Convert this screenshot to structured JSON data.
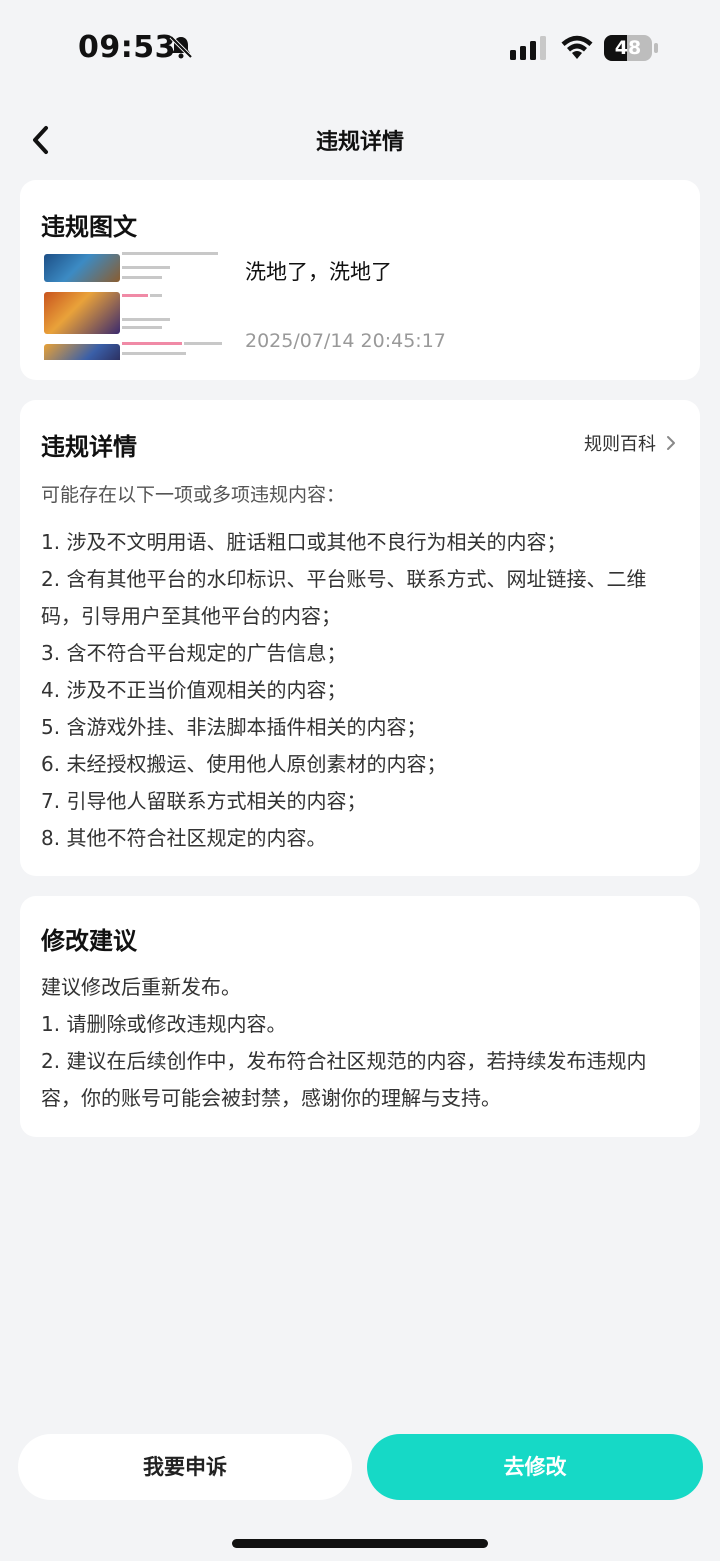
{
  "status_bar": {
    "time": "09:53",
    "battery": "48",
    "battery_level": 0.48
  },
  "nav": {
    "title": "违规详情"
  },
  "post_card": {
    "title": "违规图文",
    "post_text": "洗地了，洗地了",
    "post_time": "2025/07/14 20:45:17"
  },
  "details_card": {
    "title": "违规详情",
    "link_label": "规则百科",
    "intro": "可能存在以下一项或多项违规内容：",
    "rules": [
      "1. 涉及不文明用语、脏话粗口或其他不良行为相关的内容；",
      "2. 含有其他平台的水印标识、平台账号、联系方式、网址链接、二维码，引导用户至其他平台的内容；",
      "3. 含不符合平台规定的广告信息；",
      "4. 涉及不正当价值观相关的内容；",
      "5. 含游戏外挂、非法脚本插件相关的内容；",
      "6. 未经授权搬运、使用他人原创素材的内容；",
      "7. 引导他人留联系方式相关的内容；",
      "8. 其他不符合社区规定的内容。"
    ]
  },
  "suggestion_card": {
    "title": "修改建议",
    "lines": [
      "建议修改后重新发布。",
      "1. 请删除或修改违规内容。",
      "2. 建议在后续创作中，发布符合社区规范的内容，若持续发布违规内容，你的账号可能会被封禁，感谢你的理解与支持。"
    ]
  },
  "buttons": {
    "appeal": "我要申诉",
    "edit": "去修改"
  },
  "colors": {
    "accent": "#16d9c6",
    "background": "#f3f4f6"
  },
  "icons": [
    "bell-off-icon",
    "signal-icon",
    "wifi-icon",
    "battery-icon",
    "back-arrow-icon",
    "chevron-right-icon"
  ]
}
